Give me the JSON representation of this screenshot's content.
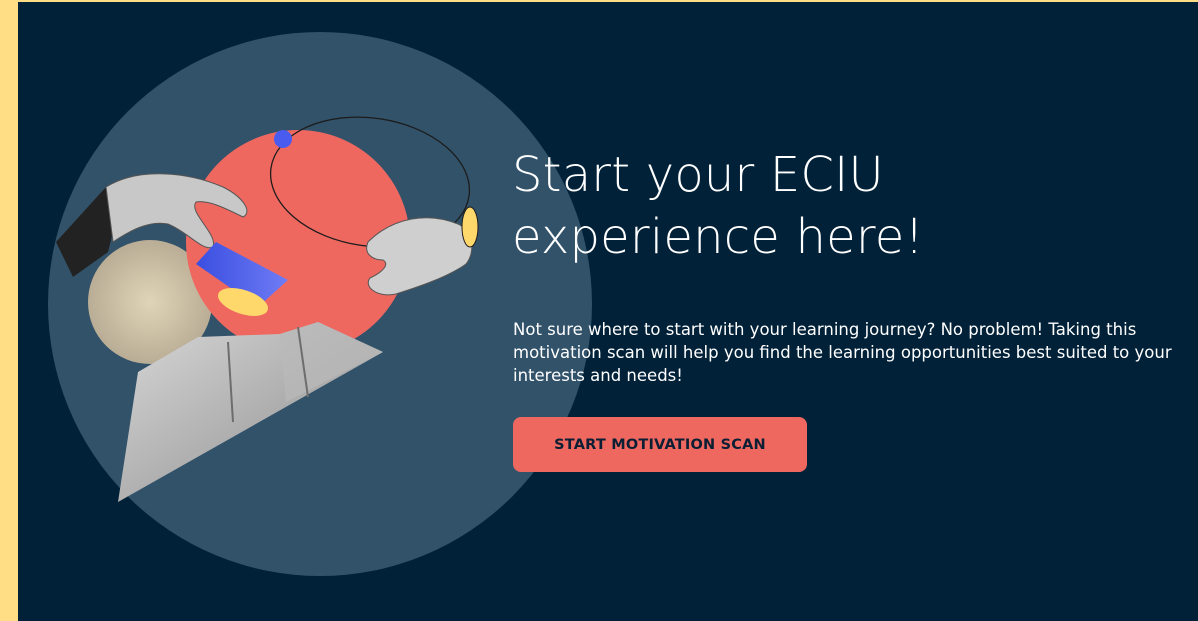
{
  "hero": {
    "title": "Start your ECIU experience here!",
    "description": "Not sure where to start with your learning journey? No problem! Taking this motivation scan will help you find the learning opportunities best suited to your interests and needs!",
    "cta_label": "START MOTIVATION SCAN"
  },
  "colors": {
    "page_border": "#ffde85",
    "background": "#012138",
    "circle_large": "#32526a",
    "circle_coral": "#ef6860",
    "button": "#ef6860",
    "button_text": "#0b1e33",
    "accent_blue": "#4a5cf0",
    "accent_yellow": "#ffd86b"
  }
}
